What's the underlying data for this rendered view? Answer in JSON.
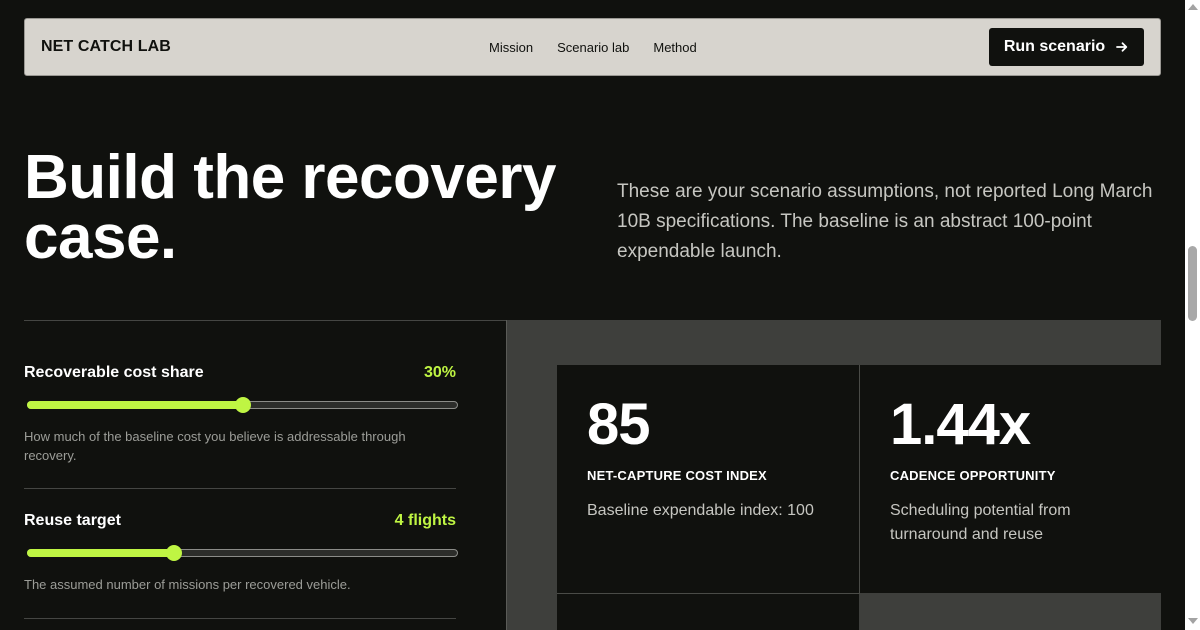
{
  "nav": {
    "brand": "NET CATCH LAB",
    "links": [
      "Mission",
      "Scenario lab",
      "Method"
    ],
    "cta_label": "Run scenario",
    "cta_icon": "arrow-right-icon"
  },
  "hero": {
    "title": "Build the recovery case.",
    "description": "These are your scenario assumptions, not reported Long March 10B specifications. The baseline is an abstract 100-point expendable launch."
  },
  "controls": [
    {
      "label": "Recoverable cost share",
      "value": "30%",
      "slider_fraction": 0.5,
      "help": "How much of the baseline cost you believe is addressable through recovery."
    },
    {
      "label": "Reuse target",
      "value": "4 flights",
      "slider_fraction": 0.34,
      "help": "The assumed number of missions per recovered vehicle."
    }
  ],
  "metrics": [
    {
      "value": "85",
      "label": "NET-CAPTURE COST INDEX",
      "note": "Baseline expendable index: 100"
    },
    {
      "value": "1.44x",
      "label": "CADENCE OPPORTUNITY",
      "note": "Scheduling potential from turnaround and reuse"
    }
  ],
  "colors": {
    "background": "#10110e",
    "nav_bg": "#d7d4ce",
    "accent": "#bff543",
    "panel": "#3e3f3c"
  }
}
